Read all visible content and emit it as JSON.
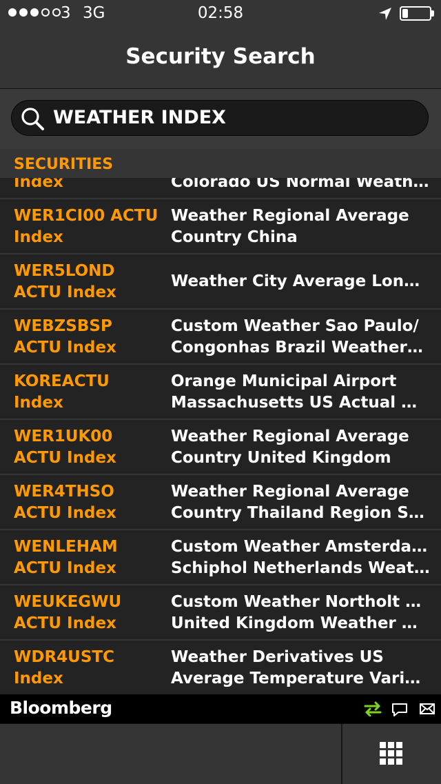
{
  "status_bar": {
    "carrier": "3",
    "network": "3G",
    "time": "02:58",
    "icons": [
      "signal-dots",
      "location-arrow-icon",
      "battery-icon"
    ],
    "battery_level": 0.2
  },
  "header": {
    "title": "Security Search"
  },
  "search": {
    "query": "WEATHER INDEX",
    "icon": "search-icon"
  },
  "section": {
    "label": "SECURITIES"
  },
  "results": [
    {
      "ticker_l1": "Index",
      "ticker_l2": "",
      "desc_l1": "Colorado US Normal Weath…",
      "desc_l2": ""
    },
    {
      "ticker_l1": "WER1CI00 ACTU",
      "ticker_l2": "Index",
      "desc_l1": "Weather Regional Average",
      "desc_l2": "Country China"
    },
    {
      "ticker_l1": "WER5LOND",
      "ticker_l2": "ACTU Index",
      "desc_l1": "Weather City Average London",
      "desc_l2": ""
    },
    {
      "ticker_l1": "WEBZSBSP",
      "ticker_l2": "ACTU Index",
      "desc_l1": "Custom Weather Sao Paulo/",
      "desc_l2": "Congonhas Brazil Weather…"
    },
    {
      "ticker_l1": "KOREACTU",
      "ticker_l2": "Index",
      "desc_l1": "Orange Municipal Airport",
      "desc_l2": "Massachusetts US Actual W…"
    },
    {
      "ticker_l1": "WER1UK00",
      "ticker_l2": "ACTU Index",
      "desc_l1": "Weather Regional Average",
      "desc_l2": "Country United Kingdom"
    },
    {
      "ticker_l1": "WER4THSO",
      "ticker_l2": "ACTU Index",
      "desc_l1": "Weather Regional Average",
      "desc_l2": "Country Thailand Region So…"
    },
    {
      "ticker_l1": "WENLEHAM",
      "ticker_l2": "ACTU Index",
      "desc_l1": "Custom Weather Amsterdam/",
      "desc_l2": "Schiphol Netherlands Weat…"
    },
    {
      "ticker_l1": "WEUKEGWU",
      "ticker_l2": "ACTU Index",
      "desc_l1": "Custom Weather Northolt Raf",
      "desc_l2": "United Kingdom Weather D…"
    },
    {
      "ticker_l1": "WDR4USTC",
      "ticker_l2": "Index",
      "desc_l1": "Weather Derivatives US",
      "desc_l2": "Average Temperature Varia…"
    }
  ],
  "footer": {
    "brand": "Bloomberg",
    "icons": [
      "transfer-arrows-icon",
      "chat-bubble-icon",
      "mail-icon"
    ],
    "toolbar_icon": "app-grid-icon"
  },
  "colors": {
    "accent": "#ff9900",
    "transfer_icon": "#7ed321",
    "background": "#232323"
  }
}
